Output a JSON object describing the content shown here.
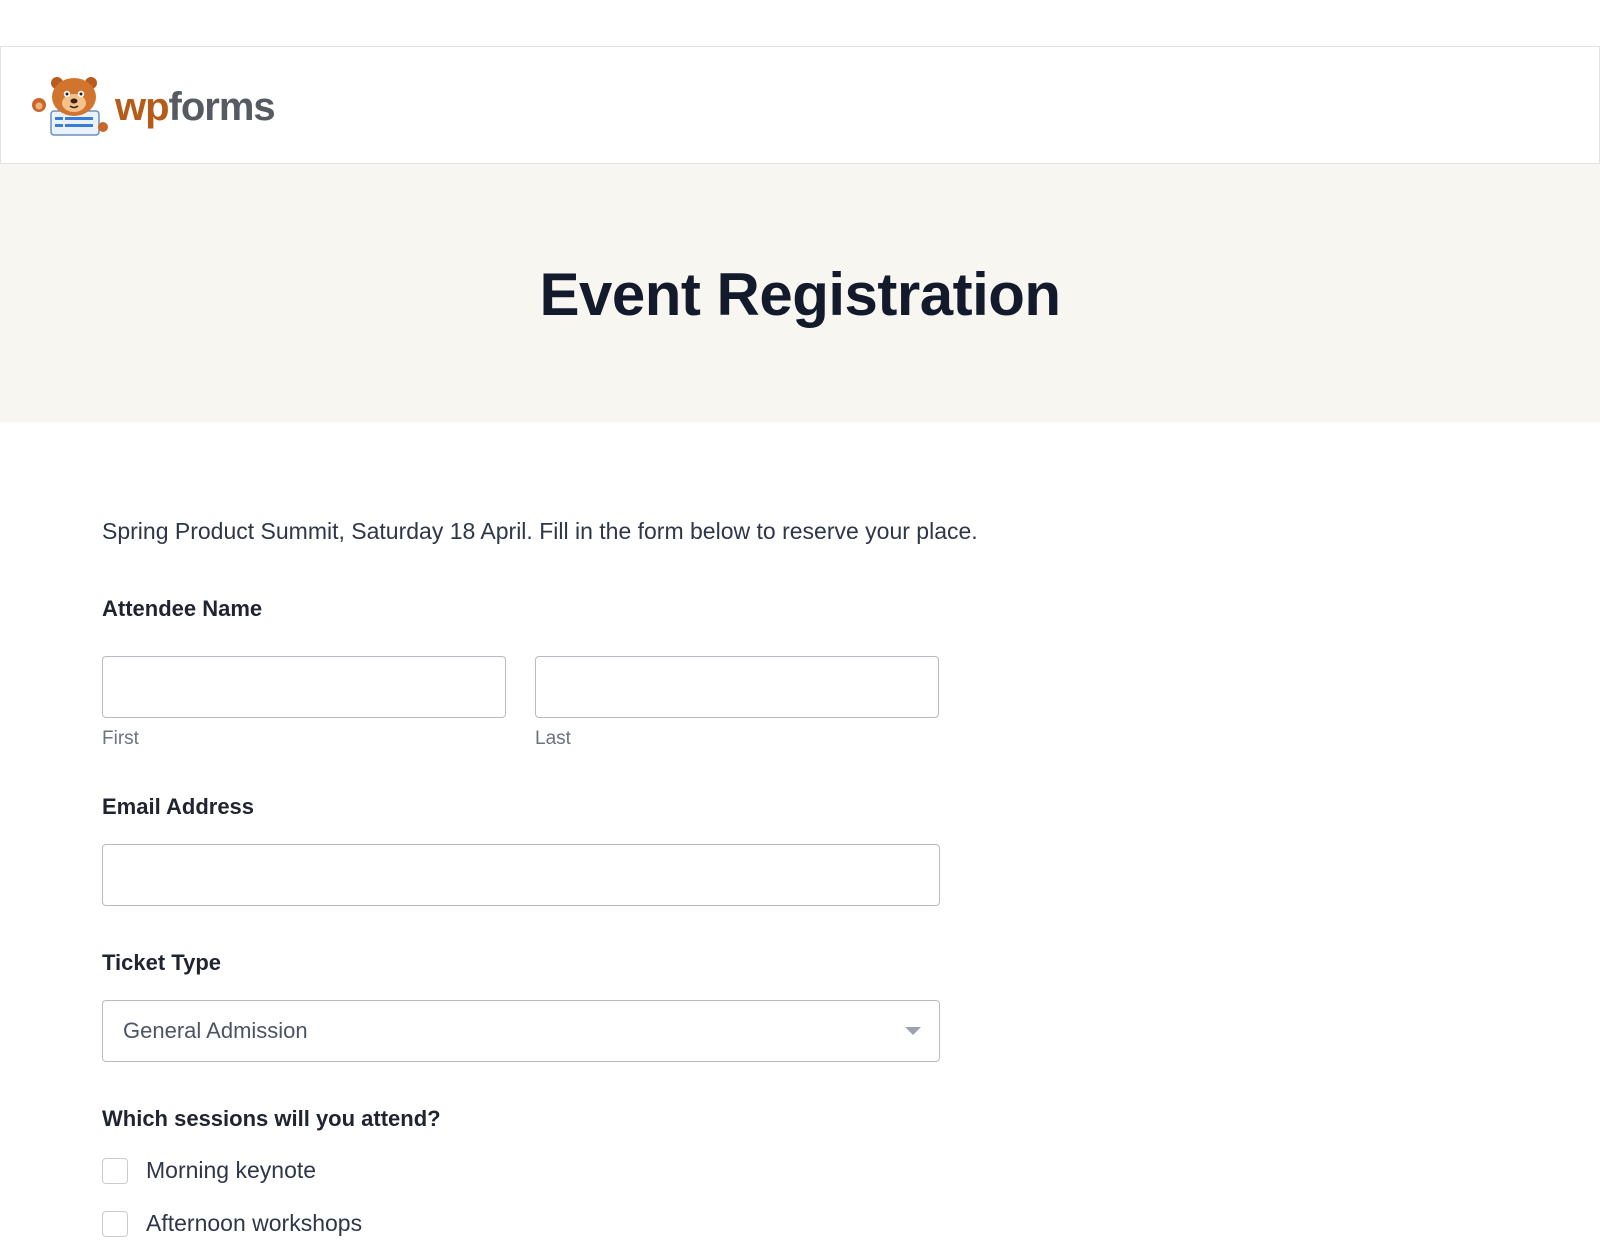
{
  "brand": {
    "name_wp": "wp",
    "name_forms": "forms",
    "color_wp": "#b65b19",
    "color_forms": "#555b61",
    "logo_icon": "bear-mascot-icon"
  },
  "hero": {
    "title": "Event Registration",
    "background": "#f8f6f1"
  },
  "form": {
    "intro": "Spring Product Summit, Saturday 18 April. Fill in the form below to reserve your place.",
    "name_field": {
      "label": "Attendee Name",
      "first_sublabel": "First",
      "last_sublabel": "Last",
      "first_value": "",
      "last_value": ""
    },
    "email_field": {
      "label": "Email Address",
      "value": ""
    },
    "ticket_field": {
      "label": "Ticket Type",
      "selected": "General Admission"
    },
    "sessions_field": {
      "label": "Which sessions will you attend?",
      "options": [
        {
          "label": "Morning keynote",
          "checked": false
        },
        {
          "label": "Afternoon workshops",
          "checked": false
        }
      ]
    }
  }
}
